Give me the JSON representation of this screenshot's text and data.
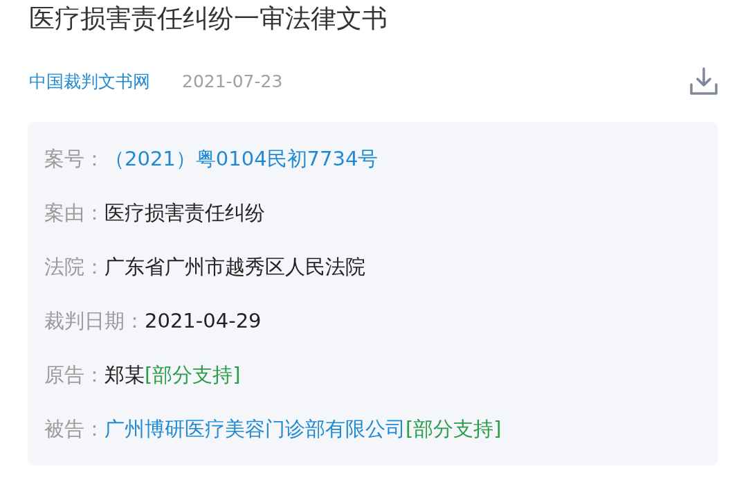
{
  "title": "医疗损害责任纠纷一审法律文书",
  "source": {
    "name": "中国裁判文书网",
    "date": "2021-07-23"
  },
  "fields": [
    {
      "label": "案号：",
      "parts": [
        {
          "text": "（2021）粤0104民初7734号",
          "kind": "link"
        }
      ]
    },
    {
      "label": "案由：",
      "parts": [
        {
          "text": "医疗损害责任纠纷",
          "kind": "plain"
        }
      ]
    },
    {
      "label": "法院：",
      "parts": [
        {
          "text": "广东省广州市越秀区人民法院",
          "kind": "plain"
        }
      ]
    },
    {
      "label": "裁判日期：",
      "parts": [
        {
          "text": "2021-04-29",
          "kind": "plain"
        }
      ]
    },
    {
      "label": "原告：",
      "parts": [
        {
          "text": "郑某",
          "kind": "plain"
        },
        {
          "text": "[部分支持]",
          "kind": "tag"
        }
      ]
    },
    {
      "label": "被告：",
      "parts": [
        {
          "text": "广州博研医疗美容门诊部有限公司",
          "kind": "link"
        },
        {
          "text": "[部分支持]",
          "kind": "tag"
        }
      ]
    }
  ]
}
